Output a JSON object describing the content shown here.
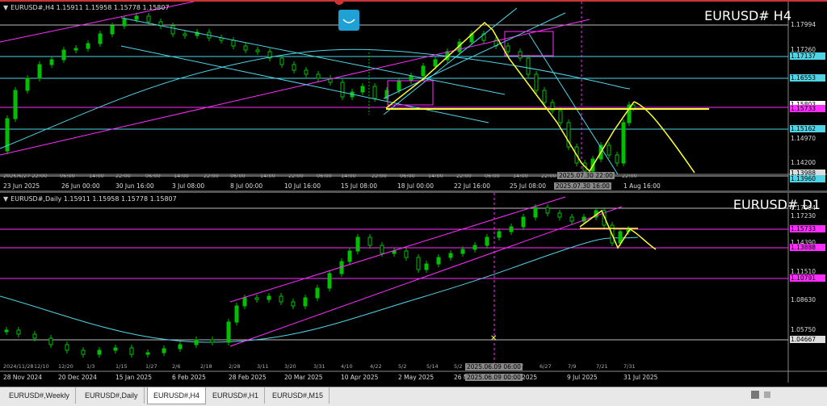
{
  "h4": {
    "symbol_line": "EURUSD#,H4  1.15911 1.15958 1.15778 1.15807",
    "watermark": "EURUSD# H4",
    "price_labels": [
      "1.17994",
      "1.17260",
      "1.17137",
      "1.16553",
      "1.15803",
      "1.15733",
      "1.15162",
      "1.14970",
      "1.14200",
      "1.13988",
      "1.13960"
    ],
    "time_labels": [
      "23 Jun 2025",
      "26 Jun 00:00",
      "30 Jun 16:00",
      "3 Jul 08:00",
      "8 Jul 00:00",
      "10 Jul 16:00",
      "15 Jul 08:00",
      "18 Jul 00:00",
      "22 Jul 16:00",
      "25 Jul 08:00",
      "1 Aug 16:00"
    ],
    "time_sub_labels": [
      "2025/6/27 22:00",
      "06:00",
      "14:00",
      "22:00",
      "06:00",
      "14:00",
      "22:00",
      "06:00",
      "14:00",
      "22:00",
      "06:00",
      "14:00",
      "22:00",
      "06:00",
      "14:00",
      "22:00",
      "06:00",
      "14:00",
      "22:00",
      "22:00"
    ],
    "crosshair_time": "2025.07.30 22:00",
    "crosshair_time_bottom": "2025.07.30 16:00",
    "colors": {
      "trend": "#ff2dff",
      "channel": "#4fd4e6",
      "zigzag": "#ffff33",
      "price": "#00c000"
    }
  },
  "d1": {
    "symbol_line": "EURUSD#,Daily  1.15911 1.15958 1.15778 1.15807",
    "watermark": "EURUSD# D1",
    "price_labels": [
      "1.17994",
      "1.17230",
      "1.15733",
      "1.14390",
      "1.13888",
      "1.11510",
      "1.10791",
      "1.08630",
      "1.05750",
      "1.04667"
    ],
    "time_labels": [
      "28 Nov 2024",
      "20 Dec 2024",
      "15 Jan 2025",
      "6 Feb 2025",
      "28 Feb 2025",
      "20 Mar 2025",
      "10 Apr 2025",
      "2 May 2025",
      "26 May 2025",
      "Jun 2025",
      "9 Jul 2025",
      "31 Jul 2025"
    ],
    "time_sub_labels": [
      "2024/11/28",
      "12/10",
      "12/20",
      "1/3",
      "1/15",
      "1/27",
      "2/6",
      "2/18",
      "2/28",
      "3/11",
      "3/20",
      "3/31",
      "4/10",
      "4/22",
      "5/2",
      "5/14",
      "5/2",
      "17",
      "6/27",
      "7/9",
      "7/21",
      "7/31"
    ],
    "crosshair_time": "2025.06.09 06:00",
    "crosshair_time_bottom": "2025.06.09 00:00"
  },
  "tabs": [
    {
      "label": "EURUSD#,Weekly",
      "active": false
    },
    {
      "label": "EURUSD#,Daily",
      "active": false
    },
    {
      "label": "EURUSD#,H4",
      "active": true
    },
    {
      "label": "EURUSD#,H1",
      "active": false
    },
    {
      "label": "EURUSD#,M15",
      "active": false
    }
  ],
  "icons": {
    "badge": "chart-badge-icon",
    "top_marker": "panel-handle-icon"
  }
}
